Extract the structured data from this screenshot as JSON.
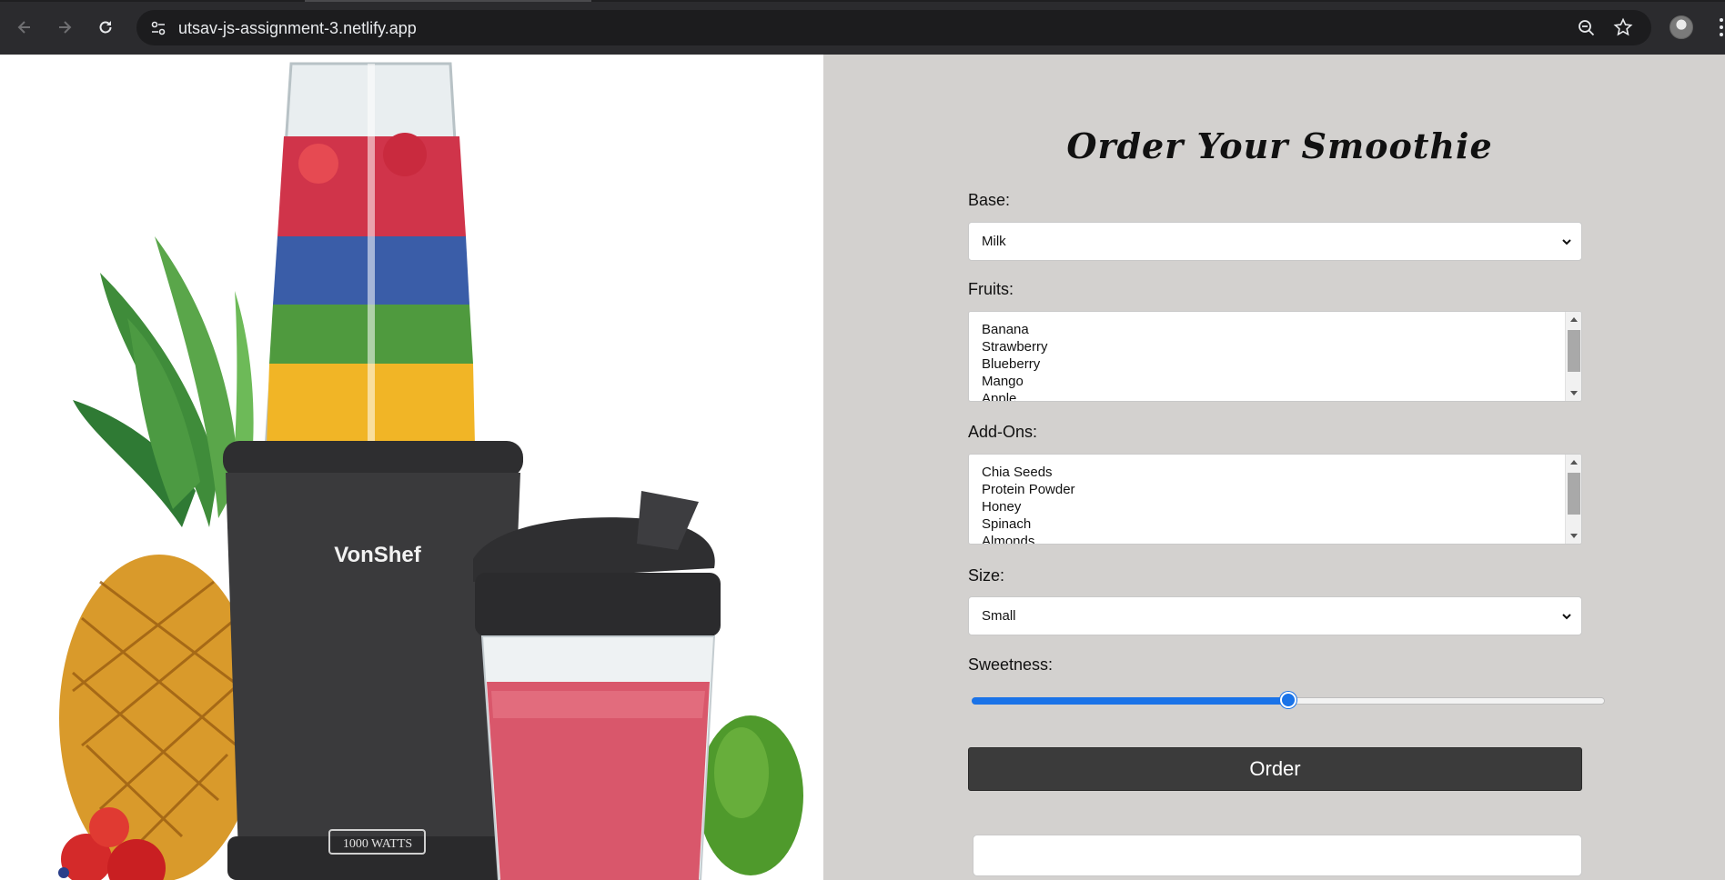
{
  "browser": {
    "url": "utsav-js-assignment-3.netlify.app"
  },
  "hero": {
    "brand_text": "VonShef",
    "wattage_text": "1000 WATTS"
  },
  "form": {
    "title": "Order Your Smoothie",
    "base": {
      "label": "Base:",
      "value": "Milk"
    },
    "fruits": {
      "label": "Fruits:",
      "options": [
        "Banana",
        "Strawberry",
        "Blueberry",
        "Mango",
        "Apple"
      ]
    },
    "addons": {
      "label": "Add-Ons:",
      "options": [
        "Chia Seeds",
        "Protein Powder",
        "Honey",
        "Spinach",
        "Almonds"
      ]
    },
    "size": {
      "label": "Size:",
      "value": "Small"
    },
    "sweetness": {
      "label": "Sweetness:",
      "value_percent": 50
    },
    "order_label": "Order",
    "result_text": ""
  },
  "colors": {
    "panel_bg": "#d3d1cf",
    "accent": "#1a73e8",
    "button_bg": "#3b3b3b"
  }
}
